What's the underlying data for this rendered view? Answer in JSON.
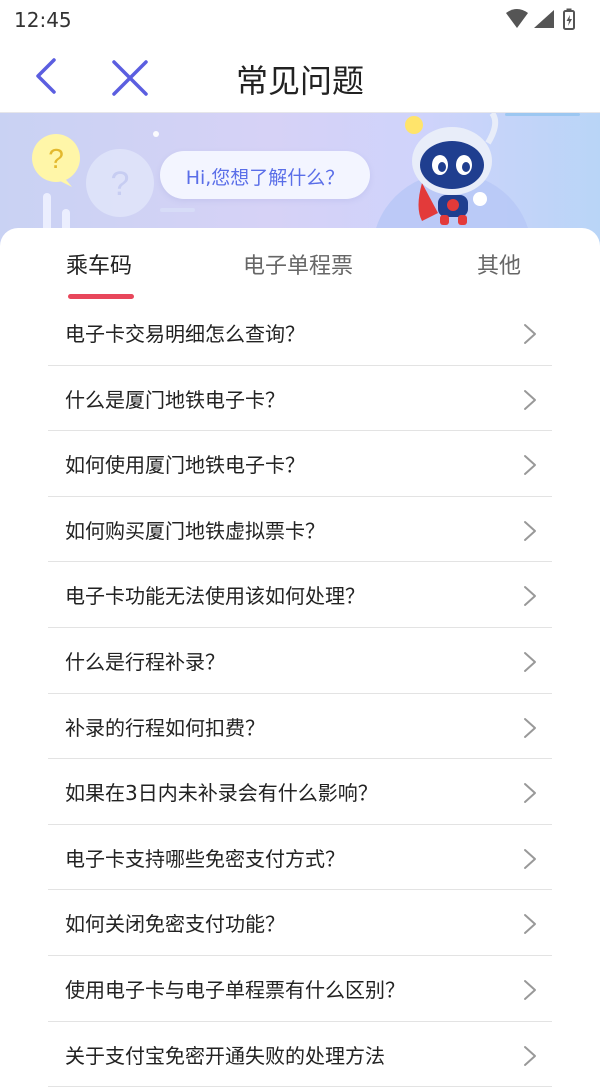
{
  "status_bar": {
    "time": "12:45"
  },
  "navbar": {
    "title": "常见问题"
  },
  "banner": {
    "greeting": "Hi,您想了解什么？"
  },
  "tabs": [
    {
      "label": "乘车码",
      "active": true
    },
    {
      "label": "电子单程票",
      "active": false
    },
    {
      "label": "其他",
      "active": false
    }
  ],
  "faq": [
    "电子卡交易明细怎么查询？",
    "什么是厦门地铁电子卡？",
    "如何使用厦门地铁电子卡？",
    "如何购买厦门地铁虚拟票卡？",
    "电子卡功能无法使用该如何处理？",
    "什么是行程补录？",
    "补录的行程如何扣费？",
    "如果在3日内未补录会有什么影响？",
    "电子卡支持哪些免密支付方式？",
    "如何关闭免密支付功能？",
    "使用电子卡与电子单程票有什么区别？",
    "关于支付宝免密开通失败的处理方法"
  ],
  "colors": {
    "accent": "#e8475b",
    "nav_icon": "#5b5ee0",
    "bubble_text": "#5a6ee8"
  }
}
